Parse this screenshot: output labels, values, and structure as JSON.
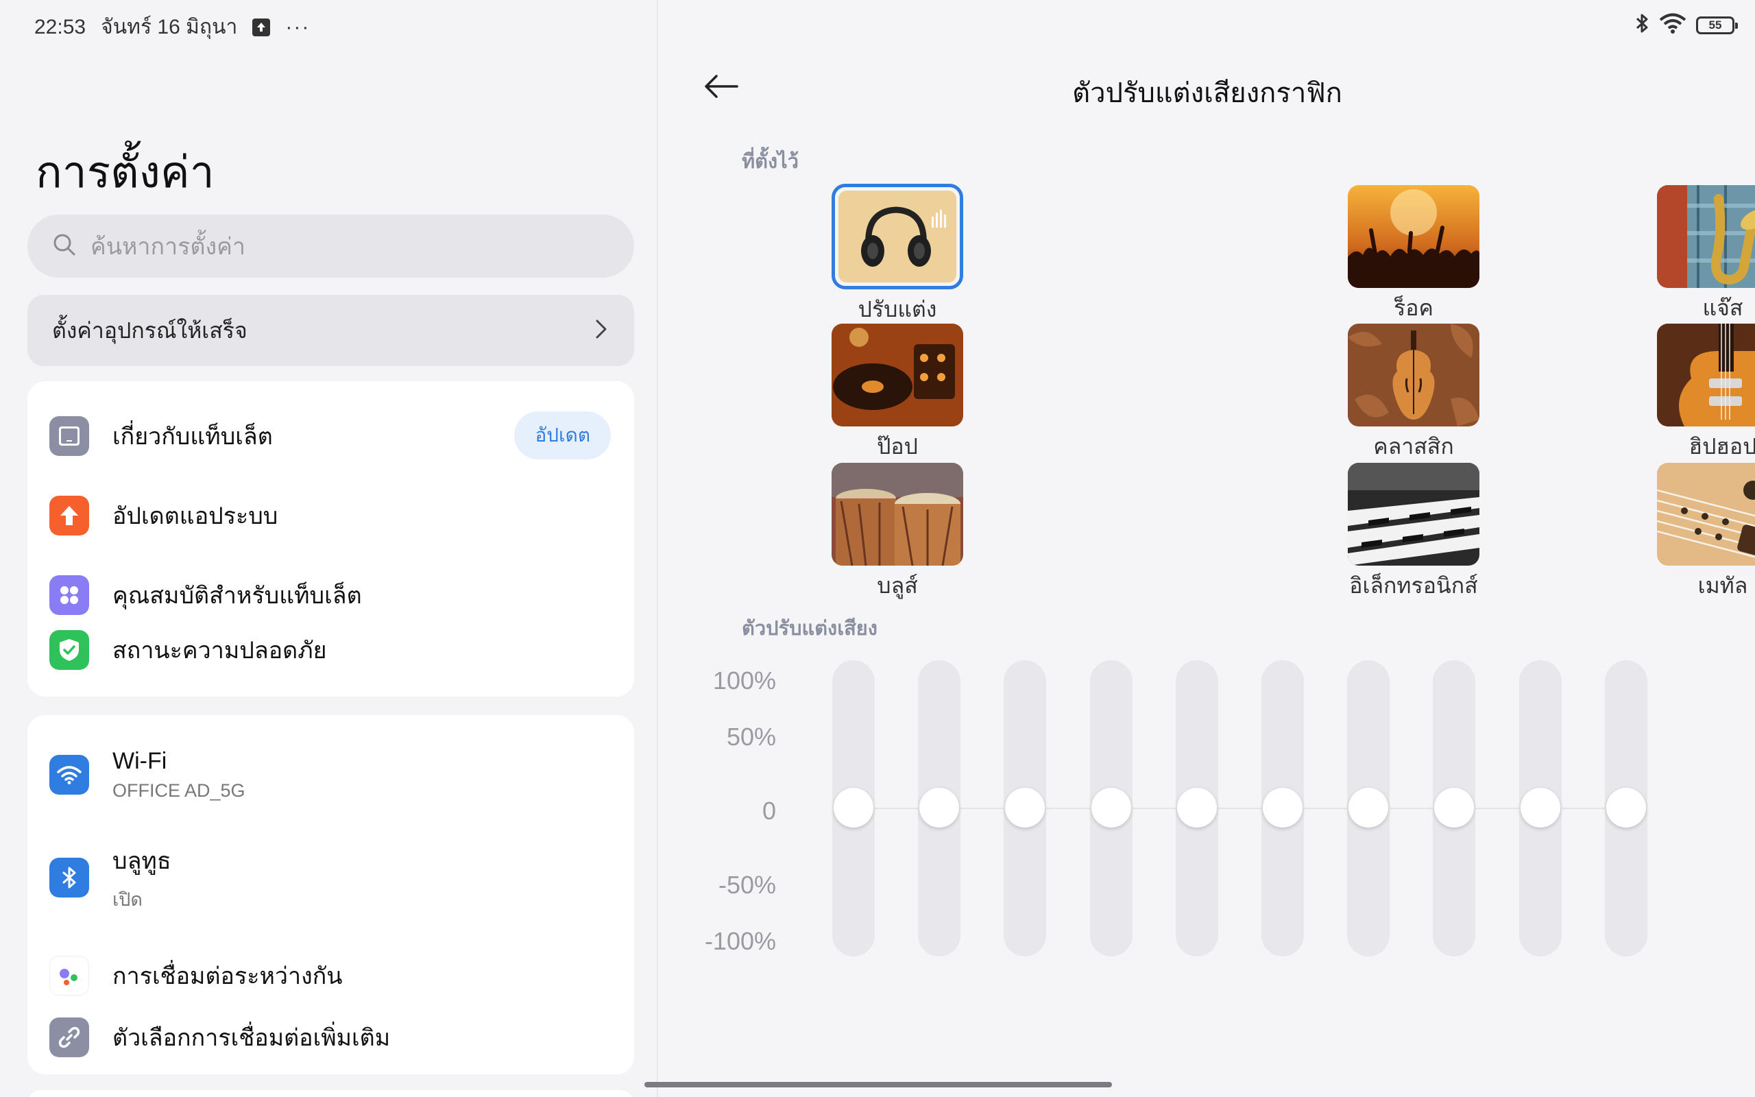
{
  "status_bar": {
    "time": "22:53",
    "date": "จันทร์ 16 มิถุนา",
    "more": "···",
    "battery": "55"
  },
  "left": {
    "title": "การตั้งค่า",
    "search_placeholder": "ค้นหาการตั้งค่า",
    "setup_banner": "ตั้งค่าอุปกรณ์ให้เสร็จ",
    "group1": [
      {
        "label": "เกี่ยวกับแท็บเล็ต",
        "icon": "tablet-icon",
        "badge": "อัปเดต"
      },
      {
        "label": "อัปเดตแอประบบ",
        "icon": "upload-arrow-icon"
      },
      {
        "label": "คุณสมบัติสำหรับแท็บเล็ต",
        "icon": "grid-dots-icon"
      },
      {
        "label": "สถานะความปลอดภัย",
        "icon": "shield-check-icon"
      }
    ],
    "group2": [
      {
        "label": "Wi-Fi",
        "sub": "OFFICE AD_5G",
        "icon": "wifi-icon"
      },
      {
        "label": "บลูทูธ",
        "sub": "เปิด",
        "icon": "bluetooth-icon"
      },
      {
        "label": "การเชื่อมต่อระหว่างกัน",
        "icon": "interconnect-icon"
      },
      {
        "label": "ตัวเลือกการเชื่อมต่อเพิ่มเติม",
        "icon": "link-icon"
      }
    ]
  },
  "right": {
    "title": "ตัวปรับแต่งเสียงกราฟิก",
    "presets_label": "ที่ตั้งไว้",
    "presets": [
      {
        "label": "ปรับแต่ง",
        "icon": "headphones-image",
        "selected": true
      },
      {
        "label": "ร็อค",
        "icon": "concert-crowd-image",
        "selected": false
      },
      {
        "label": "แจ๊ส",
        "icon": "saxophone-image",
        "selected": false
      },
      {
        "label": "ป๊อป",
        "icon": "turntable-image",
        "selected": false
      },
      {
        "label": "คลาสสิก",
        "icon": "violin-image",
        "selected": false
      },
      {
        "label": "ฮิปฮอป",
        "icon": "electric-guitar-image",
        "selected": false
      },
      {
        "label": "บลูส์",
        "icon": "drums-image",
        "selected": false
      },
      {
        "label": "อิเล็กทรอนิกส์",
        "icon": "keyboard-image",
        "selected": false
      },
      {
        "label": "เมทัล",
        "icon": "guitar-strings-image",
        "selected": false
      }
    ],
    "equalizer_label": "ตัวปรับแต่งเสียง",
    "scale_labels": [
      "100%",
      "50%",
      "0",
      "-50%",
      "-100%"
    ],
    "band_levels_percent": [
      0,
      0,
      0,
      0,
      0,
      0,
      0,
      0,
      0,
      0
    ]
  },
  "colors": {
    "accent": "#2f7de1",
    "update_orange": "#f5602d",
    "features_purple": "#8a7cf5",
    "security_green": "#2fc15a",
    "wifi_blue": "#2f7de1"
  }
}
